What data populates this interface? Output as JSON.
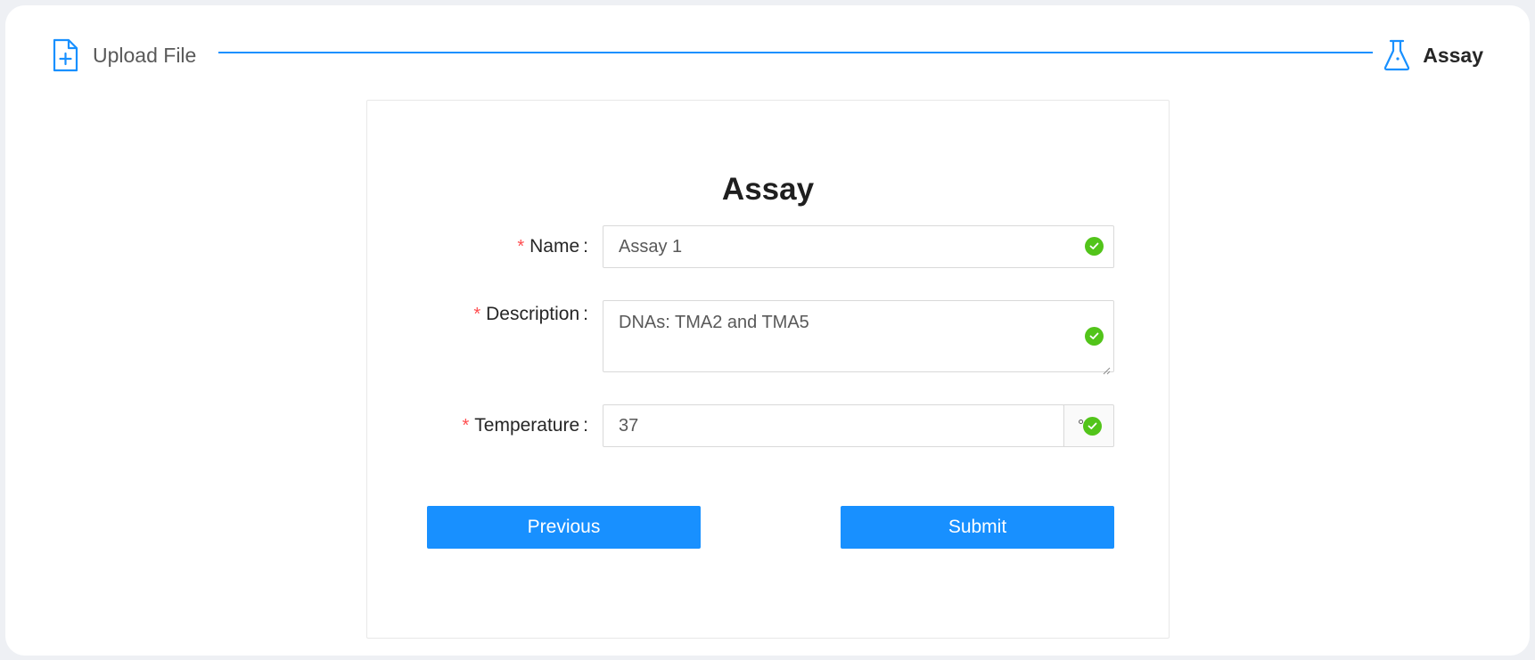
{
  "steps": [
    {
      "label": "Upload File",
      "icon": "file-add-icon"
    },
    {
      "label": "Assay",
      "icon": "flask-icon"
    }
  ],
  "form": {
    "title": "Assay",
    "name": {
      "label": "Name",
      "value": "Assay 1"
    },
    "description": {
      "label": "Description",
      "value": "DNAs: TMA2 and TMA5"
    },
    "temperature": {
      "label": "Temperature",
      "value": "37",
      "unit": "°"
    }
  },
  "buttons": {
    "previous": "Previous",
    "submit": "Submit"
  },
  "colors": {
    "primary": "#1890ff",
    "success": "#52c41a",
    "required": "#ff4d4f"
  }
}
